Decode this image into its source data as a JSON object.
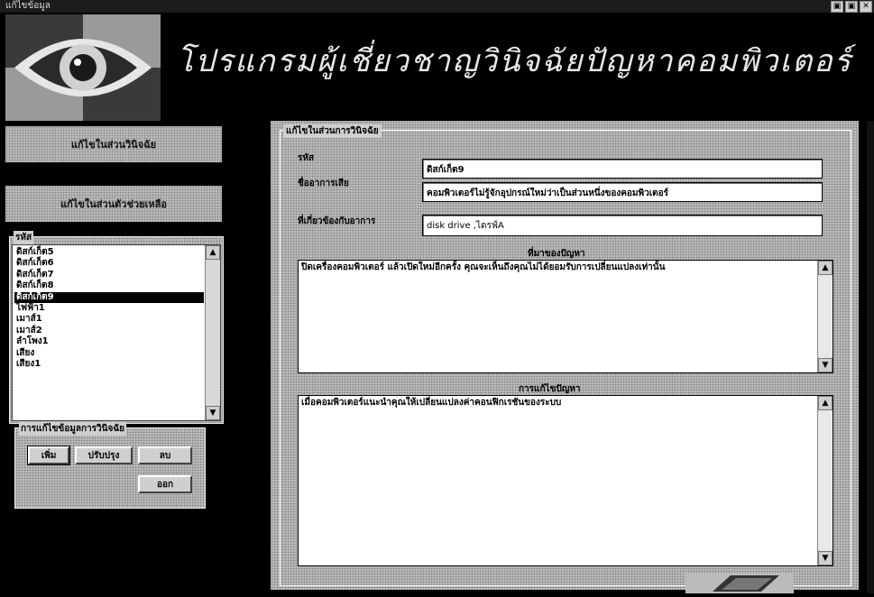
{
  "window": {
    "title": "แก้ไขข้อมูล",
    "buttons": [
      "▣",
      "▣",
      "✕"
    ]
  },
  "banner": {
    "title": "โปรแกรมผู้เชี่ยวชาญวินิจฉัยปัญหาคอมพิวเตอร์"
  },
  "sidebar": {
    "btn_diagnosis": "แก้ไขในส่วนวินิจฉัย",
    "btn_help": "แก้ไขในส่วนตัวช่วยเหลือ",
    "list_label": "รหัส",
    "items": [
      "ดิสก์เก็ต5",
      "ดิสก์เก็ต6",
      "ดิสก์เก็ต7",
      "ดิสก์เก็ต8",
      "ดิสก์เก็ต9",
      "ไฟฟ้า1",
      "เมาส์1",
      "เมาส์2",
      "ลำโพง1",
      "เสียง",
      "เสียง1"
    ],
    "selected_index": 4
  },
  "edit_group": {
    "label": "การแก้ไขข้อมูลการวินิจฉัย",
    "add": "เพิ่ม",
    "update": "ปรับปรุง",
    "delete": "ลบ",
    "exit": "ออก"
  },
  "main": {
    "group_label": "แก้ไขในส่วนการวินิจฉัย",
    "code_label": "รหัส",
    "code_value": "ดิสก์เก็ต9",
    "symptom_label": "ชื่ออาการเสีย",
    "symptom_value": "คอมพิวเตอร์ไม่รู้จักอุปกรณ์ใหม่ว่าเป็นส่วนหนึ่งของคอมพิวเตอร์",
    "related_label": "ที่เกี่ยวข้องกับอาการ",
    "related_value": "disk drive ,ไดรฟ์A",
    "cause_label": "ที่มาของปัญหา",
    "cause_value": "ปิดเครื่องคอมพิวเตอร์ แล้วเปิดใหม่อีกครั้ง คุณจะเห็นถึงคุณไม่ได้ยอมรับการเปลี่ยนแปลงเท่านั้น",
    "solution_label": "การแก้ไขปัญหา",
    "solution_value": "เมื่อคอมพิวเตอร์แนะนำคุณให้เปลี่ยนแปลงค่าคอนฟิกเรชันของระบบ"
  },
  "colors": {
    "background": "#000000",
    "panel": "#bcbcbc",
    "selection": "#000000"
  }
}
